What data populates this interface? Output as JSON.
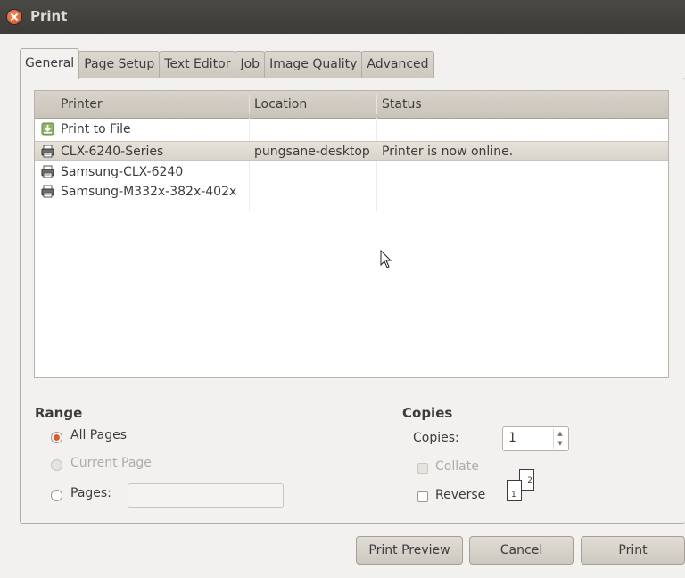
{
  "window": {
    "title": "Print"
  },
  "tabs": [
    "General",
    "Page Setup",
    "Text Editor",
    "Job",
    "Image Quality",
    "Advanced"
  ],
  "printer_list": {
    "columns": [
      "Printer",
      "Location",
      "Status"
    ],
    "rows": [
      {
        "name": "Print to File",
        "location": "",
        "status": "",
        "icon": "file-download-icon"
      },
      {
        "name": "CLX-6240-Series",
        "location": "pungsane-desktop",
        "status": "Printer is now online.",
        "icon": "printer-icon",
        "selected": true
      },
      {
        "name": "Samsung-CLX-6240",
        "location": "",
        "status": "",
        "icon": "printer-icon"
      },
      {
        "name": "Samsung-M332x-382x-402x",
        "location": "",
        "status": "",
        "icon": "printer-icon"
      }
    ]
  },
  "range": {
    "title": "Range",
    "all_pages": "All Pages",
    "current_page": "Current Page",
    "pages": "Pages:",
    "pages_value": ""
  },
  "copies": {
    "title": "Copies",
    "copies_label": "Copies:",
    "copies_value": "1",
    "collate": "Collate",
    "reverse": "Reverse",
    "page1": "1",
    "page2": "2"
  },
  "buttons": {
    "preview": "Print Preview",
    "cancel": "Cancel",
    "print": "Print"
  },
  "colors": {
    "titlebar": "#3c3b37",
    "accent_radio": "#e25a2a",
    "selected_row": "#dcd7ce"
  }
}
